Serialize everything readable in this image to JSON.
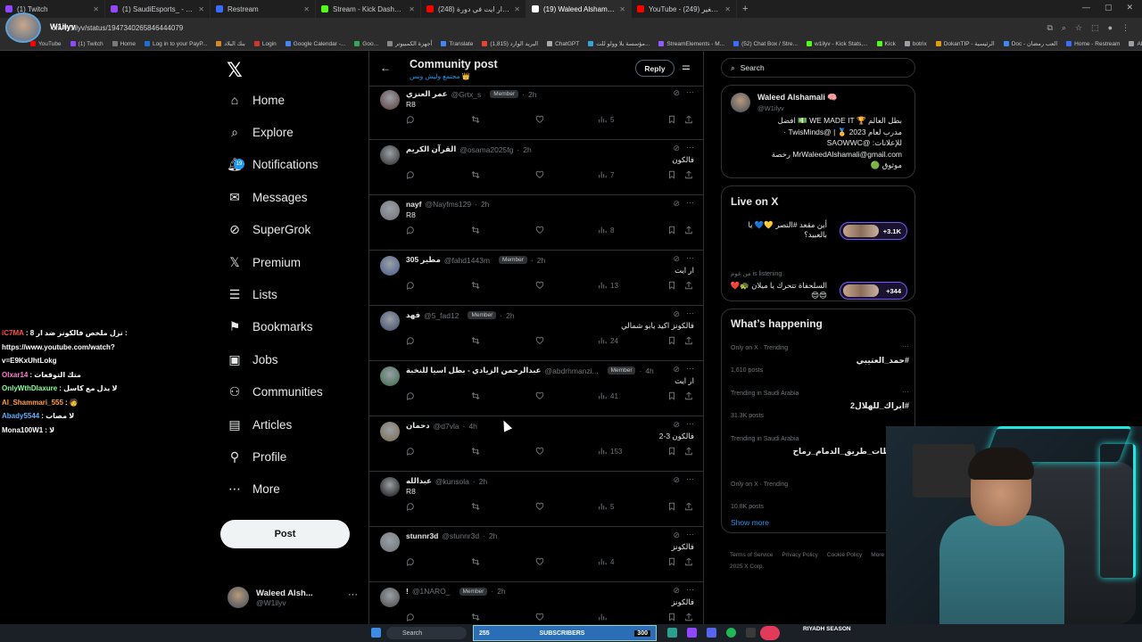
{
  "browser": {
    "tabs": [
      {
        "title": "(1) Twitch",
        "color": "#9146ff",
        "active": false
      },
      {
        "title": "(1) SaudiEsports_ - Twitch",
        "color": "#9146ff",
        "active": false
      },
      {
        "title": "Restream",
        "color": "#3b6cff",
        "active": false
      },
      {
        "title": "Stream - Kick Dashboard",
        "color": "#53fc18",
        "active": false
      },
      {
        "title": "(248) فالكونز ضد ار ايت في دورة...",
        "color": "#ff0000",
        "active": false
      },
      {
        "title": "(19) Waleed Alshamali 🧠 on X:",
        "color": "#ffffff",
        "active": true
      },
      {
        "title": "YouTube - الاثنين الصغير (249)",
        "color": "#ff0000",
        "active": false
      }
    ],
    "url": "om/W1ilyv/status/1947340265846444079",
    "streamer_name": "W1ilyv",
    "bookmarks": [
      {
        "label": "YouTube",
        "color": "#ff0000"
      },
      {
        "label": "(1) Twitch",
        "color": "#9146ff"
      },
      {
        "label": "Home",
        "color": "#7a7a7a"
      },
      {
        "label": "Log in to your PayP...",
        "color": "#1f6fd1"
      },
      {
        "label": "بنك البلاد",
        "color": "#d08a2b"
      },
      {
        "label": "Login",
        "color": "#d2352a"
      },
      {
        "label": "Google Calendar -...",
        "color": "#4285f4"
      },
      {
        "label": "Goo...",
        "color": "#34a853"
      },
      {
        "label": "أجهزة الكمبيوتر",
        "color": "#888888"
      },
      {
        "label": "Translate",
        "color": "#4285f4"
      },
      {
        "label": "البريد الوارد (1,815)",
        "color": "#ea4335"
      },
      {
        "label": "ChatGPT",
        "color": "#aaaaaa"
      },
      {
        "label": "مؤسسة بلا وولو للت...",
        "color": "#3aa0d8"
      },
      {
        "label": "StreamElements - M...",
        "color": "#8f5cff"
      },
      {
        "label": "(52) Chat Box / Stre...",
        "color": "#3b6cff"
      },
      {
        "label": "w1ilyv - Kick Stats,...",
        "color": "#53fc18"
      },
      {
        "label": "Kick",
        "color": "#53fc18"
      },
      {
        "label": "botrix",
        "color": "#9aa0a6"
      },
      {
        "label": "DokanTIP - الرئيسية",
        "color": "#e0a100"
      },
      {
        "label": "Doc - العب رمضان",
        "color": "#4285f4"
      },
      {
        "label": "Home - Restream",
        "color": "#3b6cff"
      },
      {
        "label": "All Bookmarks",
        "color": "#9aa0a6"
      }
    ]
  },
  "nav": {
    "items": [
      {
        "label": "Home",
        "icon": "home-icon"
      },
      {
        "label": "Explore",
        "icon": "search-icon"
      },
      {
        "label": "Notifications",
        "icon": "bell-icon"
      },
      {
        "label": "Messages",
        "icon": "mail-icon"
      },
      {
        "label": "SuperGrok",
        "icon": "grok-icon"
      },
      {
        "label": "Premium",
        "icon": "x-logo-icon"
      },
      {
        "label": "Lists",
        "icon": "list-icon"
      },
      {
        "label": "Bookmarks",
        "icon": "bookmark-icon"
      },
      {
        "label": "Jobs",
        "icon": "briefcase-icon"
      },
      {
        "label": "Communities",
        "icon": "people-icon"
      },
      {
        "label": "Articles",
        "icon": "article-icon"
      },
      {
        "label": "Profile",
        "icon": "person-icon"
      },
      {
        "label": "More",
        "icon": "more-circle-icon"
      }
    ],
    "notifications_badge": "19",
    "post_button": "Post",
    "account": {
      "name": "Waleed Alsh...",
      "handle": "@W1ilyv"
    }
  },
  "main": {
    "title": "Community post",
    "subtitle": "مجتمع وليش وبس 👑",
    "reply_button": "Reply",
    "posts": [
      {
        "name": "عمر العنزي",
        "handle": "@Grtx_s",
        "member": true,
        "time": "2h",
        "text": "R8",
        "dir": "ltr",
        "views": "5",
        "avatar": "#5b3a3a"
      },
      {
        "name": "القرآن الكريم",
        "handle": "@osama2025fg",
        "member": false,
        "time": "2h",
        "text": "فالكون",
        "dir": "rtl",
        "views": "7",
        "avatar": "#2a2a2a"
      },
      {
        "name": "nayf",
        "handle": "@Nayfms129",
        "member": false,
        "time": "2h",
        "text": "R8",
        "dir": "ltr",
        "views": "8",
        "avatar": "#6e7278"
      },
      {
        "name": "305 مطير",
        "handle": "@fahd1443m",
        "member": true,
        "time": "2h",
        "text": "ار ايت",
        "dir": "rtl",
        "views": "13",
        "avatar": "#4a5a8a"
      },
      {
        "name": "فهد",
        "handle": "@5_fad12",
        "member": true,
        "time": "2h",
        "text": "فالكونز اكيد يابو شمالي",
        "dir": "rtl",
        "views": "24",
        "avatar": "#3e4a6a"
      },
      {
        "name": "عبدالرحمن الزيادي - بطل اسيا للنخبة",
        "handle": "@abdrhmanzi...",
        "member": true,
        "time": "4h",
        "text": "ار ايت",
        "dir": "rtl",
        "views": "41",
        "avatar": "#3a6a4a"
      },
      {
        "name": "دحمان",
        "handle": "@d7vla",
        "member": false,
        "time": "4h",
        "text": "فالكون 3-2",
        "dir": "rtl",
        "views": "153",
        "avatar": "#7a6a4a"
      },
      {
        "name": "عبدالله",
        "handle": "@kunsola",
        "member": false,
        "time": "2h",
        "text": "R8",
        "dir": "ltr",
        "views": "5",
        "avatar": "#111111"
      },
      {
        "name": "stunnr3d",
        "handle": "@stunnr3d",
        "member": false,
        "time": "2h",
        "text": "فالكونز",
        "dir": "rtl",
        "views": "4",
        "avatar": "#6e7278"
      },
      {
        "name": "!",
        "handle": "@1NARO_",
        "member": true,
        "time": "2h",
        "text": "فالكونز",
        "dir": "rtl",
        "views": "",
        "avatar": "#4a4a4a"
      }
    ],
    "member_label": "Member"
  },
  "right": {
    "search_placeholder": "Search",
    "profile": {
      "name": "Waleed Alshamali 🧠",
      "handle": "@W1ilyv",
      "bio_lines": [
        "بطل العالم 🏆 WE MADE IT 💵 افضل",
        "مدرب لعام 2023 🥇 | @TwisMinds ·",
        "للإعلانات: @SAOWWC",
        "MrWaleedAlshamali@gmail.com رخصة",
        "موثوق 🟢"
      ]
    },
    "live": {
      "title": "Live on X",
      "items": [
        {
          "host": "",
          "text": "أين مقعد #النصر 💛💙 يا بالعبيد؟",
          "count": "+3.1K"
        },
        {
          "host": "من غوم is listening",
          "text": "السلحفاة تتحرك يا ميلان 🐢❤️ 😍😍",
          "count": "+344"
        }
      ]
    },
    "happening": {
      "title": "What’s happening",
      "trends": [
        {
          "context": "Only on X · Trending",
          "name": "#حمد_العتيبي",
          "count": "1,610 posts"
        },
        {
          "context": "Trending in Saudi Arabia",
          "name": "#ابراك_للهلال2",
          "count": "31.3K posts"
        },
        {
          "context": "Trending in Saudi Arabia",
          "name": "مخططات_طريق_الدمام_رماح",
          "count": ""
        },
        {
          "context": "Only on X · Trending",
          "name": "سس",
          "count": "10.8K posts"
        }
      ],
      "show_more": "Show more"
    },
    "footer": [
      "Terms of Service",
      "Privacy Policy",
      "Cookie Policy",
      "More ···",
      "© 2025 X Corp."
    ]
  },
  "chat": [
    {
      "user": "iC7MA",
      "color": "#ff4f4f",
      "message": "نزل ملخص فالكونز ضد ار 8 : https://www.youtube.com/watch?v=E9KxUhtLokg"
    },
    {
      "user": "Olxar14",
      "color": "#ff7ad9",
      "message": "متك التوقعات"
    },
    {
      "user": "OnlyWthDlaxure",
      "color": "#8aff9d",
      "message": "لا يدل مع كاسل"
    },
    {
      "user": "Al_Shammari_555",
      "color": "#ff9f43",
      "message": "🧑"
    },
    {
      "user": "Abady5544",
      "color": "#5ab0ff",
      "message": "لا مصاب"
    },
    {
      "user": "Mona100W1",
      "color": "#ffffff",
      "message": "لا"
    }
  ],
  "taskbar": {
    "search": "Search",
    "subs_current": "255",
    "subs_label": "SUBSCRIBERS",
    "subs_goal": "300",
    "riyadh": "RIYADH SEASON"
  }
}
